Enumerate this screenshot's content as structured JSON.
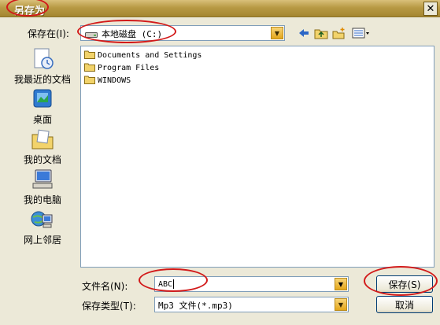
{
  "window": {
    "title": "另存为",
    "close_glyph": "✕"
  },
  "location": {
    "label": "保存在(I):",
    "value": "本地磁盘 (C:)",
    "drive_icon": "drive-icon"
  },
  "toolbar": [
    "back-arrow-icon",
    "up-folder-icon",
    "new-folder-icon",
    "view-menu-icon"
  ],
  "places": [
    {
      "label": "我最近的文档",
      "icon": "recent-documents-icon"
    },
    {
      "label": "桌面",
      "icon": "desktop-icon"
    },
    {
      "label": "我的文档",
      "icon": "my-documents-icon"
    },
    {
      "label": "我的电脑",
      "icon": "my-computer-icon"
    },
    {
      "label": "网上邻居",
      "icon": "network-places-icon"
    }
  ],
  "files": [
    {
      "name": "Documents and Settings"
    },
    {
      "name": "Program Files"
    },
    {
      "name": "WINDOWS"
    }
  ],
  "filename": {
    "label": "文件名(N):",
    "value": "ABC"
  },
  "filetype": {
    "label": "保存类型(T):",
    "value": "Mp3 文件(*.mp3)"
  },
  "buttons": {
    "save": "保存(S)",
    "cancel": "取消"
  },
  "colors": {
    "annotation": "#d21a1a",
    "titlebar": "#b89a45",
    "dialog_bg": "#ece9d8"
  }
}
